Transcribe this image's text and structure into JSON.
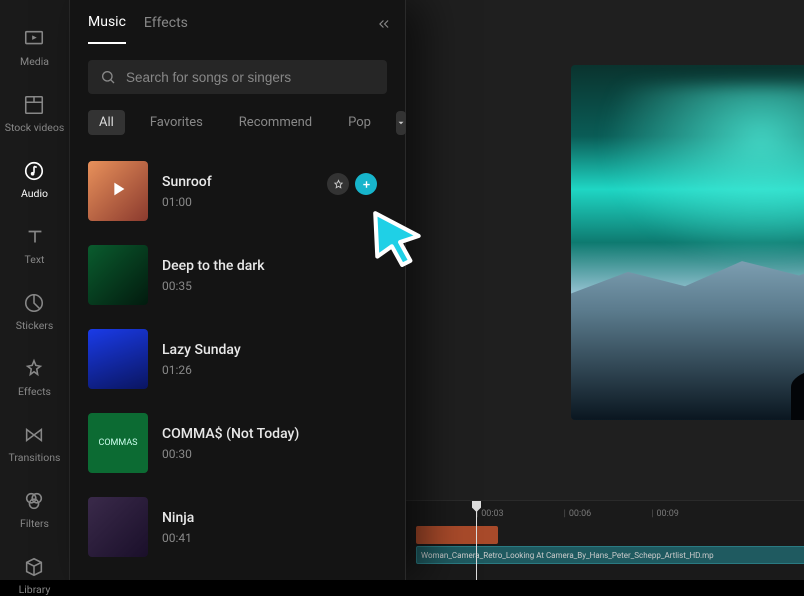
{
  "sidebar": [
    {
      "key": "media",
      "label": "Media"
    },
    {
      "key": "stock",
      "label": "Stock videos"
    },
    {
      "key": "audio",
      "label": "Audio"
    },
    {
      "key": "text",
      "label": "Text"
    },
    {
      "key": "stickers",
      "label": "Stickers"
    },
    {
      "key": "effects",
      "label": "Effects"
    },
    {
      "key": "transitions",
      "label": "Transitions"
    },
    {
      "key": "filters",
      "label": "Filters"
    },
    {
      "key": "library",
      "label": "Library"
    }
  ],
  "panel": {
    "tabs": {
      "music": "Music",
      "effects": "Effects"
    },
    "search_placeholder": "Search for songs or singers",
    "filters": {
      "all": "All",
      "favorites": "Favorites",
      "recommend": "Recommend",
      "pop": "Pop"
    }
  },
  "tracks": [
    {
      "title": "Sunroof",
      "duration": "01:00"
    },
    {
      "title": "Deep to the dark",
      "duration": "00:35"
    },
    {
      "title": "Lazy Sunday",
      "duration": "01:26"
    },
    {
      "title": "COMMA$ (Not Today)",
      "duration": "00:30"
    },
    {
      "title": "Ninja",
      "duration": "00:41"
    }
  ],
  "timeline": {
    "marks": [
      "00:03",
      "00:06",
      "00:09"
    ],
    "clip_label": "Woman_Camera_Retro_Looking At Camera_By_Hans_Peter_Schepp_Artlist_HD.mp"
  },
  "commas_thumb_text": "COMMAS"
}
